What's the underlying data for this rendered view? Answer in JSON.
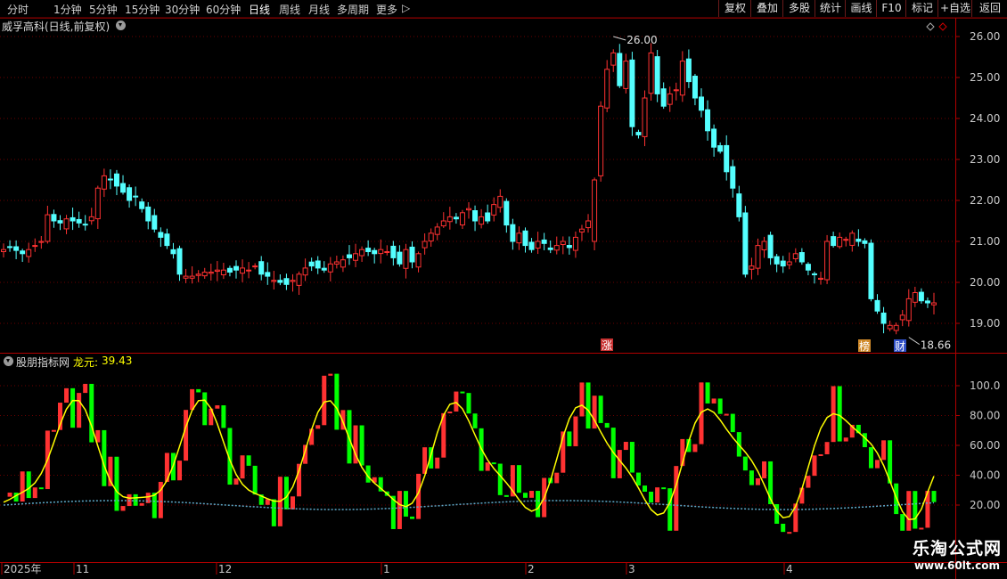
{
  "toolbar": {
    "periods": [
      "分时",
      "1分钟",
      "5分钟",
      "15分钟",
      "30分钟",
      "60分钟",
      "日线",
      "周线",
      "月线",
      "多周期",
      "更多"
    ],
    "active_period": "日线",
    "buttons": [
      "复权",
      "叠加",
      "多股",
      "统计",
      "画线",
      "F10",
      "标记",
      "+自选",
      "返回"
    ]
  },
  "main_pane": {
    "title": "威孚高科(日线,前复权)",
    "high_marker": "26.00",
    "low_marker": "18.66",
    "badges": [
      {
        "text": "涨",
        "color": "#c83232"
      },
      {
        "text": "榜",
        "color": "#d08a2a"
      },
      {
        "text": "财",
        "color": "#3050c8"
      }
    ]
  },
  "indicator_pane": {
    "name": "股朋指标网",
    "line_label": "龙元:",
    "line_value": "39.43"
  },
  "watermark": {
    "title": "乐淘公式网",
    "url": "www.60lt.com"
  },
  "chart_data": [
    {
      "type": "candlestick",
      "name": "威孚高科(日线,前复权)",
      "ylim": [
        18.4,
        26.4
      ],
      "y_ticks": [
        "26.00",
        "25.00",
        "24.00",
        "23.00",
        "22.00",
        "21.00",
        "20.00",
        "19.00"
      ],
      "x_ticks": [
        "2025年",
        "11",
        "12",
        "1",
        "2",
        "3",
        "4"
      ],
      "annotations": [
        "26.00",
        "18.66",
        "涨",
        "榜",
        "财"
      ],
      "closes": [
        20.8,
        20.85,
        20.78,
        20.7,
        20.8,
        20.9,
        21.0,
        21.65,
        21.5,
        21.45,
        21.55,
        21.5,
        21.45,
        21.4,
        21.6,
        22.3,
        22.6,
        22.5,
        22.35,
        22.2,
        22.0,
        22.1,
        21.8,
        21.5,
        21.3,
        21.1,
        20.9,
        20.7,
        20.2,
        20.15,
        20.15,
        20.2,
        20.25,
        20.25,
        20.3,
        20.3,
        20.25,
        20.3,
        20.35,
        20.3,
        20.4,
        20.2,
        20.15,
        20.05,
        20.0,
        19.95,
        20.05,
        20.2,
        20.35,
        20.4,
        20.35,
        20.3,
        20.45,
        20.5,
        20.55,
        20.6,
        20.7,
        20.8,
        20.75,
        20.7,
        20.8,
        20.75,
        20.6,
        20.45,
        20.8,
        20.5,
        20.7,
        21.0,
        21.2,
        21.35,
        21.5,
        21.6,
        21.55,
        21.7,
        21.8,
        21.5,
        21.6,
        21.5,
        21.9,
        22.1,
        21.4,
        21.0,
        21.2,
        20.9,
        20.8,
        21.0,
        20.95,
        20.8,
        20.9,
        21.0,
        20.85,
        21.1,
        21.3,
        21.5,
        22.5,
        24.3,
        25.2,
        25.6,
        24.8,
        25.4,
        23.8,
        23.6,
        24.5,
        25.6,
        24.6,
        24.3,
        24.6,
        24.7,
        25.4,
        24.9,
        24.5,
        24.2,
        23.7,
        23.3,
        23.2,
        22.7,
        22.3,
        21.6,
        20.2,
        20.4,
        20.9,
        21.0,
        20.6,
        20.45,
        20.4,
        20.5,
        20.7,
        20.5,
        20.3,
        20.2,
        20.1,
        21.0,
        20.9,
        21.1,
        21.05,
        21.2,
        21.0,
        20.95,
        19.6,
        19.3,
        19.0,
        18.95,
        18.95,
        19.2,
        19.6,
        19.75,
        19.55,
        19.5,
        19.5
      ]
    },
    {
      "type": "line",
      "name": "股朋指标网",
      "ylim": [
        0,
        115
      ],
      "y_ticks": [
        "100.0",
        "80.00",
        "60.00",
        "40.00",
        "20.00"
      ],
      "series": [
        {
          "name": "龙元",
          "color": "#ffff00",
          "last_value": 39.43
        }
      ]
    }
  ]
}
